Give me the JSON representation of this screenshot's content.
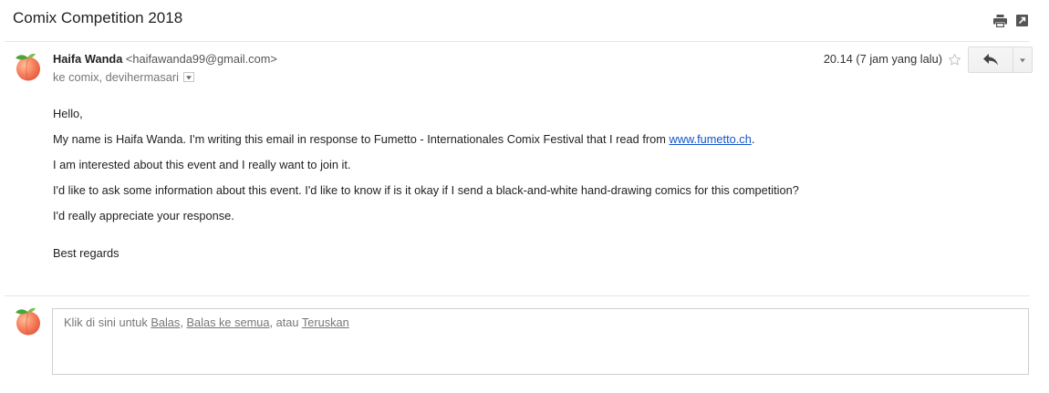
{
  "thread": {
    "subject": "Comix Competition 2018"
  },
  "icons": {
    "print": "print-icon",
    "new_window": "open-in-new-window-icon",
    "star": "star-icon",
    "reply": "reply-arrow-icon",
    "more": "chevron-down-icon",
    "avatar": "peach-avatar"
  },
  "message": {
    "sender": {
      "name": "Haifa Wanda",
      "email": "<haifawanda99@gmail.com>"
    },
    "recipients": "ke comix, devihermasari",
    "timestamp": "20.14 (7 jam yang lalu)",
    "starred": false,
    "body": {
      "greeting": "Hello,",
      "paragraph_1": {
        "before_link": "My name is Haifa Wanda. I'm writing this email in response to Fumetto - Internationales Comix Festival that I read from ",
        "link": "www.fumetto.ch",
        "after_link": "."
      },
      "paragraph_2": "I am interested about this event and I really want to join it.",
      "paragraph_3": "I'd like to ask some information about this event. I'd like to know if is it okay if I send a black-and-white hand-drawing comics for this competition?",
      "paragraph_4": "I'd really appreciate your response.",
      "closing": "Best regards"
    }
  },
  "reply_box": {
    "prompt": "Klik di sini untuk ",
    "reply_label": "Balas",
    "separator_1": ", ",
    "reply_all_label": "Balas ke semua",
    "separator_2": ", atau ",
    "forward_label": "Teruskan"
  },
  "colors": {
    "text": "#222222",
    "secondary_text": "#777777",
    "sender_email": "#555555",
    "link": "#1155cc",
    "divider": "#e5e5e5",
    "avatar_peach": "#f47c5c",
    "avatar_leaf": "#4ea537"
  }
}
